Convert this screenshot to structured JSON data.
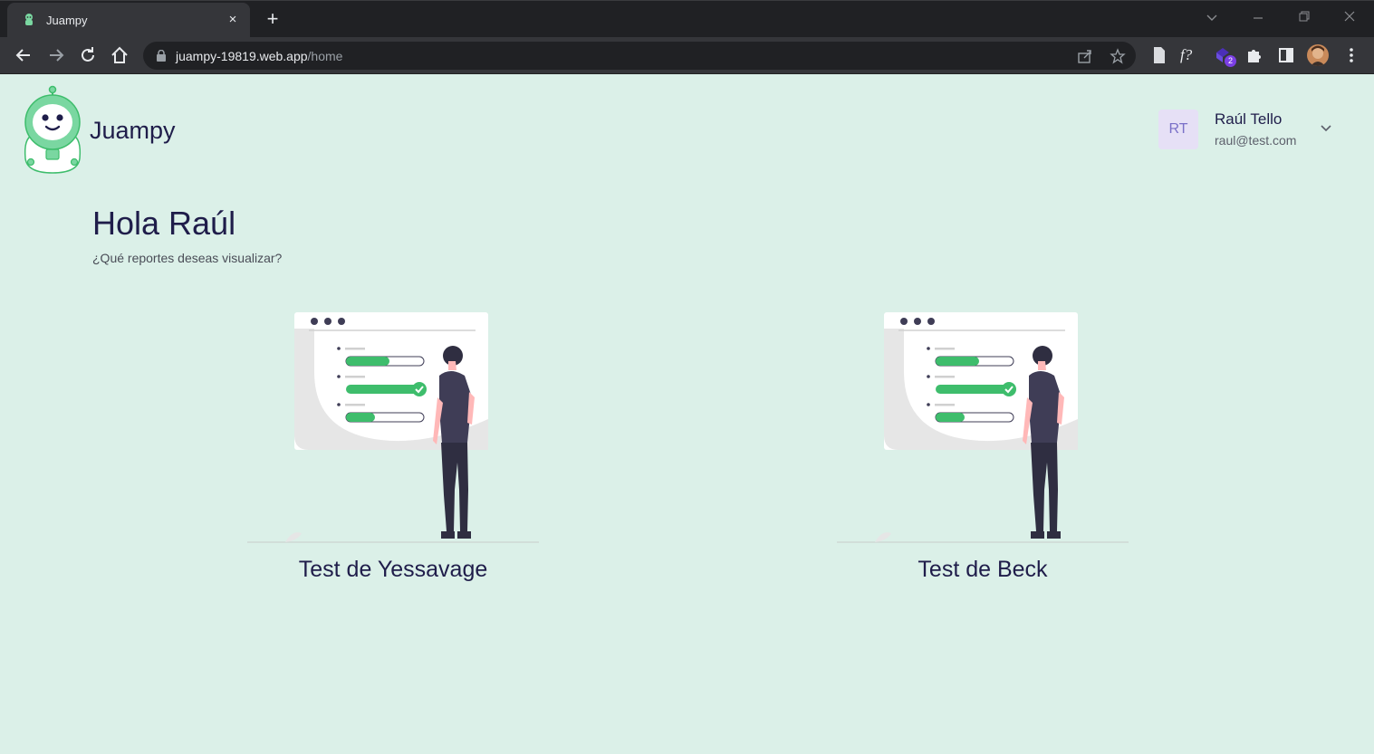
{
  "browser": {
    "tab_title": "Juampy",
    "tab_close": "×",
    "new_tab": "+",
    "url_host": "juampy-19819.web.app",
    "url_path": "/home",
    "extension_badge": "2",
    "extension_f_label": "f?"
  },
  "header": {
    "brand": "Juampy",
    "user": {
      "initials": "RT",
      "name": "Raúl Tello",
      "email": "raul@test.com"
    }
  },
  "main": {
    "greeting": "Hola Raúl",
    "subtitle": "¿Qué reportes deseas visualizar?",
    "cards": [
      {
        "title": "Test de Yessavage"
      },
      {
        "title": "Test de Beck"
      }
    ]
  },
  "colors": {
    "page_background": "#dbf0e8",
    "text_primary": "#1f1d4a",
    "accent_green": "#3ebd6c",
    "avatar_bg": "#e6e0f6",
    "avatar_text": "#7a70c8"
  },
  "icons": [
    "robot-logo-icon",
    "back-icon",
    "forward-icon",
    "reload-icon",
    "home-icon",
    "lock-icon",
    "share-icon",
    "star-icon",
    "chevron-down-icon"
  ]
}
